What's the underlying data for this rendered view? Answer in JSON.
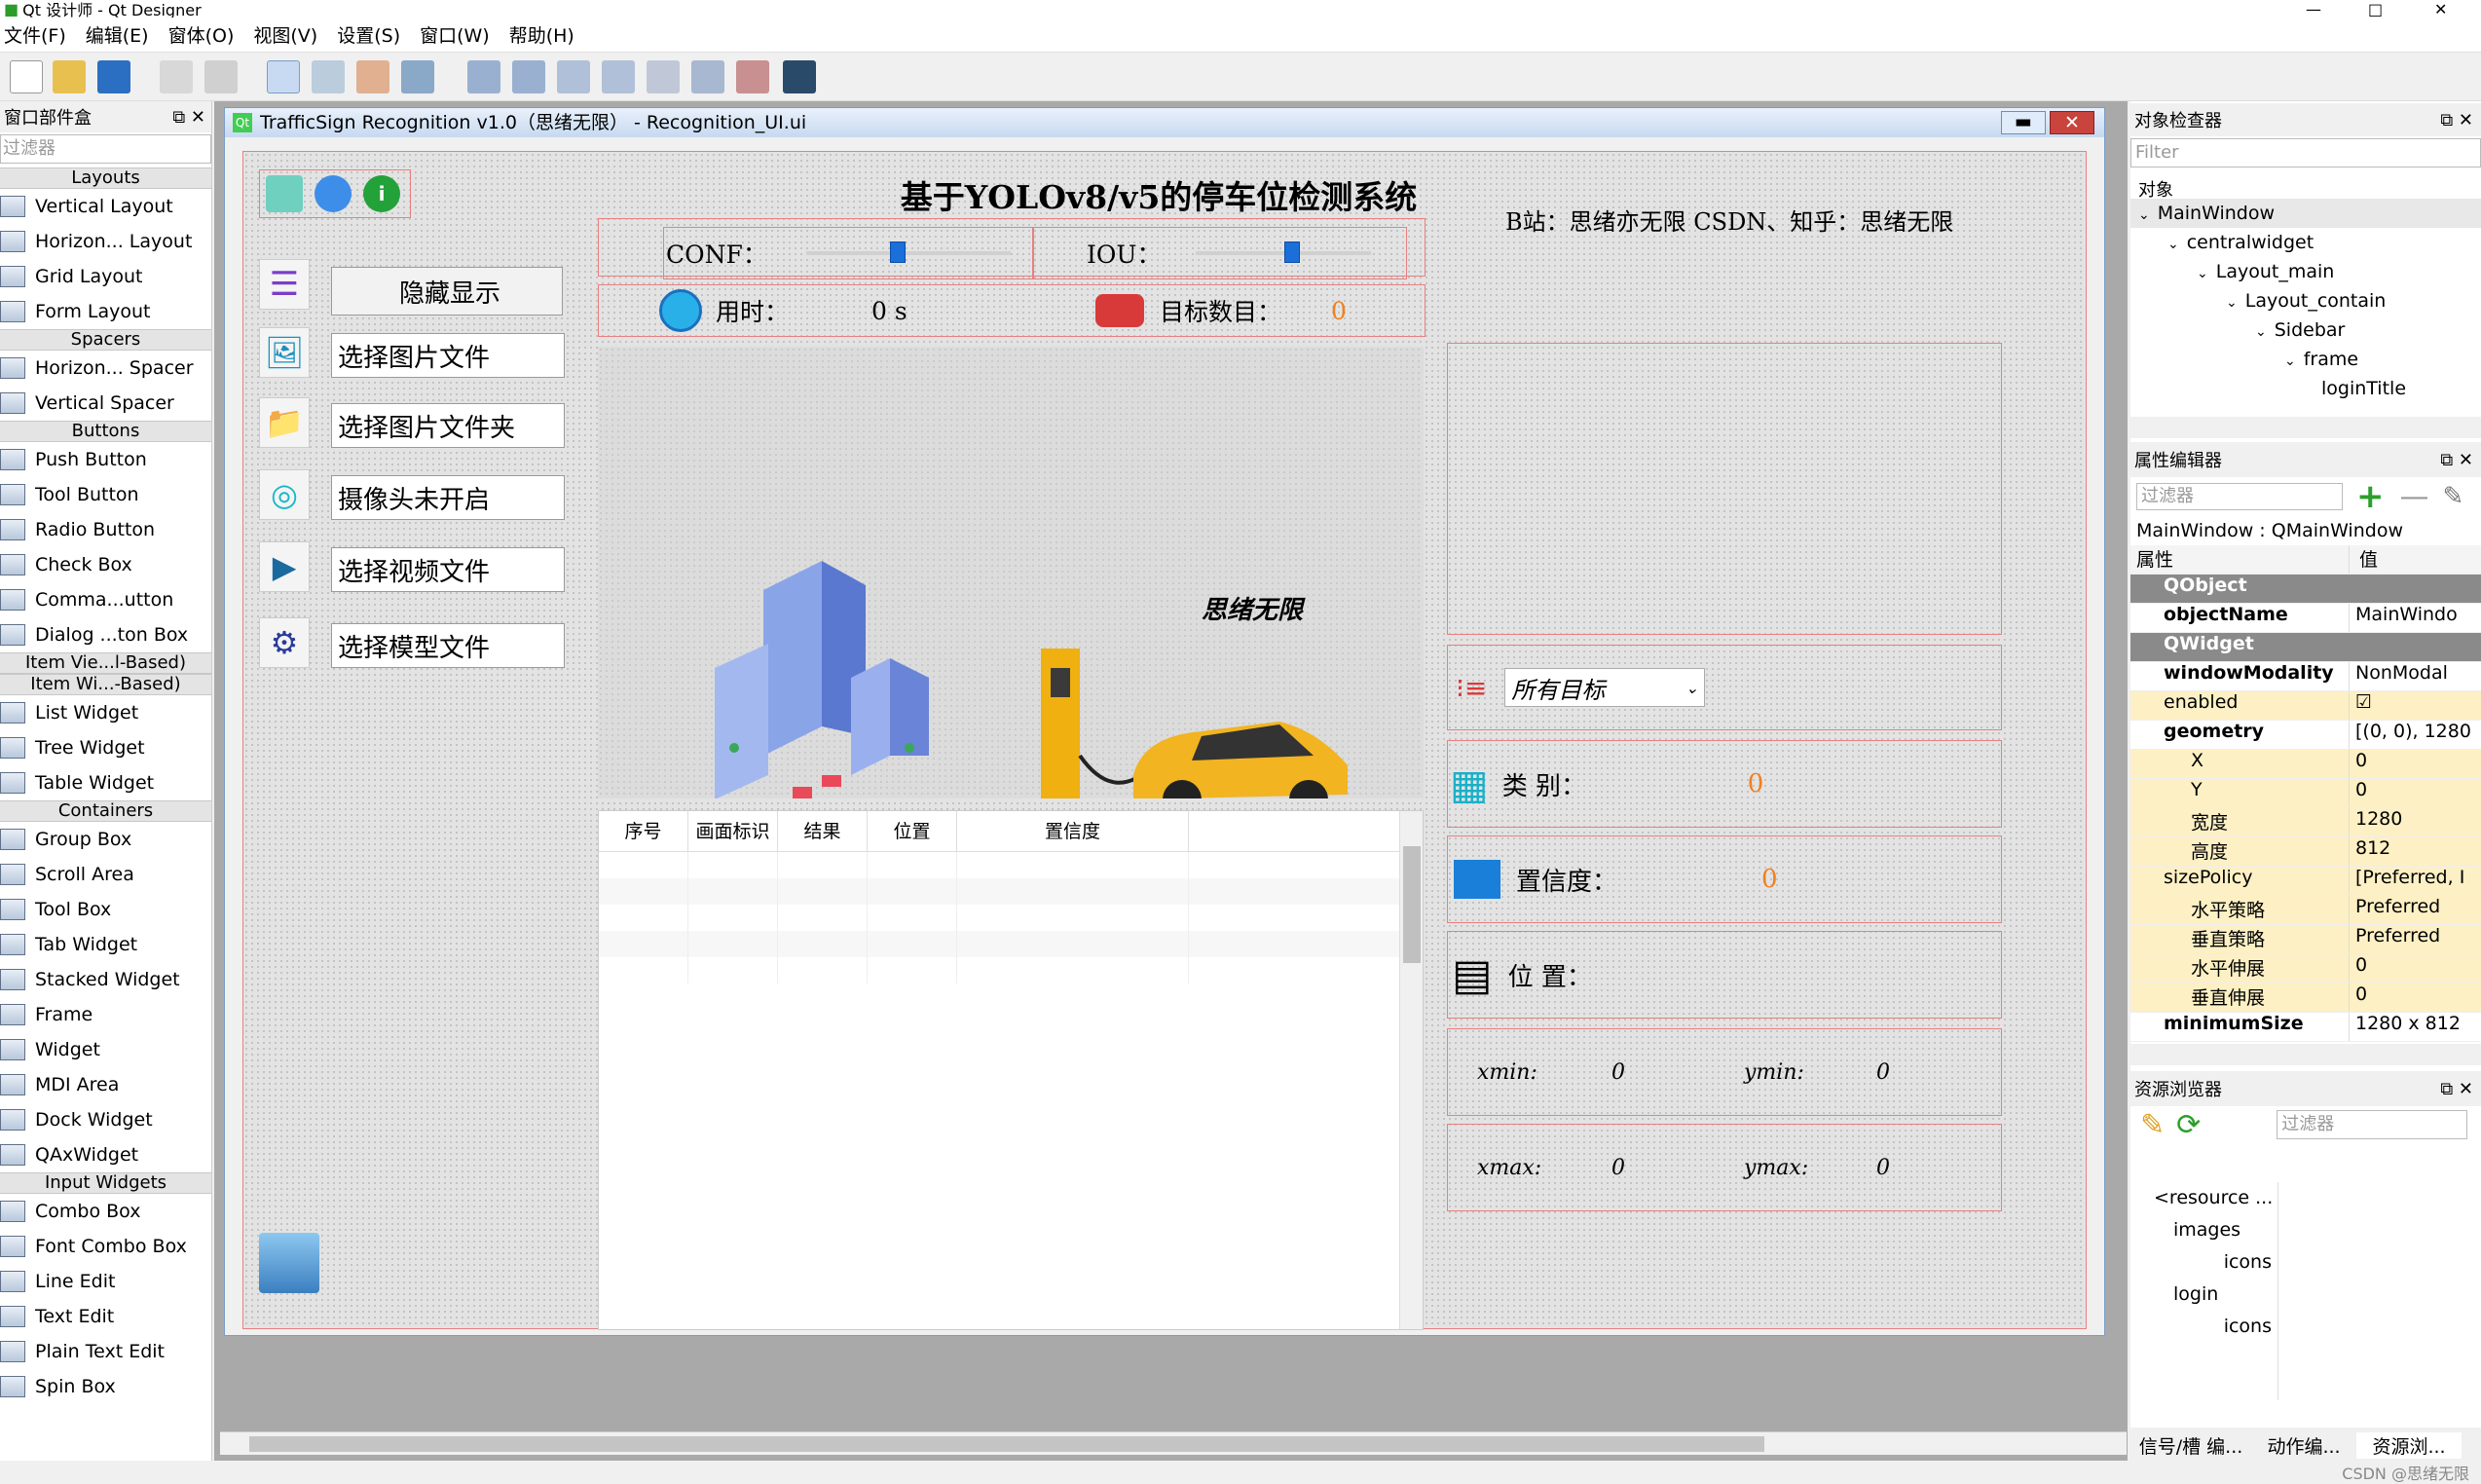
{
  "window": {
    "title": "Qt 设计师 - Qt Designer"
  },
  "menu": [
    "文件(F)",
    "编辑(E)",
    "窗体(O)",
    "视图(V)",
    "设置(S)",
    "窗口(W)",
    "帮助(H)"
  ],
  "widgetbox": {
    "title": "窗口部件盒",
    "filter": "过滤器",
    "sections": [
      {
        "cat": "Layouts",
        "items": [
          "Vertical Layout",
          "Horizon... Layout",
          "Grid Layout",
          "Form Layout"
        ]
      },
      {
        "cat": "Spacers",
        "items": [
          "Horizon... Spacer",
          "Vertical Spacer"
        ]
      },
      {
        "cat": "Buttons",
        "items": [
          "Push Button",
          "Tool Button",
          "Radio Button",
          "Check Box",
          "Comma...utton",
          "Dialog ...ton Box"
        ]
      },
      {
        "cat": "Item Vie...l-Based)",
        "items": []
      },
      {
        "cat": "Item Wi...-Based)",
        "items": [
          "List Widget",
          "Tree Widget",
          "Table Widget"
        ]
      },
      {
        "cat": "Containers",
        "items": [
          "Group Box",
          "Scroll Area",
          "Tool Box",
          "Tab Widget",
          "Stacked Widget",
          "Frame",
          "Widget",
          "MDI Area",
          "Dock Widget",
          "QAxWidget"
        ]
      },
      {
        "cat": "Input Widgets",
        "items": [
          "Combo Box",
          "Font Combo Box",
          "Line Edit",
          "Text Edit",
          "Plain Text Edit",
          "Spin Box"
        ]
      }
    ]
  },
  "form": {
    "title": "TrafficSign Recognition v1.0（思绪无限） - Recognition_UI.ui",
    "heading": "基于YOLOv8/v5的停车位检测系统",
    "sidebar": [
      "隐藏显示",
      "选择图片文件",
      "选择图片文件夹",
      "摄像头未开启",
      "选择视频文件",
      "选择模型文件"
    ],
    "conf_label": "CONF：",
    "iou_label": "IOU：",
    "conf": 0.45,
    "iou": 0.55,
    "time_label": "用时：",
    "time_value": "0 s",
    "count_label": "目标数目：",
    "count_value": "0",
    "brand_text": "思绪无限",
    "table_headers": [
      "序号",
      "画面标识",
      "结果",
      "位置",
      "置信度"
    ],
    "info": "B站：思绪亦无限 CSDN、知乎：思绪无限",
    "target_select": "所有目标",
    "class_label": "类 别：",
    "class_value": "0",
    "conf2_label": "置信度：",
    "conf2_value": "0",
    "pos_label": "位 置：",
    "xmin_label": "xmin:",
    "xmin": "0",
    "ymin_label": "ymin:",
    "ymin": "0",
    "xmax_label": "xmax:",
    "xmax": "0",
    "ymax_label": "ymax:",
    "ymax": "0"
  },
  "inspector": {
    "title": "对象检查器",
    "filter": "Filter",
    "col": "对象",
    "tree": [
      "MainWindow",
      "centralwidget",
      "Layout_main",
      "Layout_contain",
      "Sidebar",
      "frame",
      "loginTitle"
    ]
  },
  "props": {
    "title": "属性编辑器",
    "filter": "过滤器",
    "classline": "MainWindow : QMainWindow",
    "col_prop": "属性",
    "col_val": "值",
    "rows": [
      [
        "QObject",
        "",
        "grp"
      ],
      [
        "objectName",
        "MainWindo",
        "bold"
      ],
      [
        "QWidget",
        "",
        "grp"
      ],
      [
        "windowModality",
        "NonModal",
        "bold"
      ],
      [
        "enabled",
        "☑",
        "y"
      ],
      [
        "geometry",
        "[(0, 0), 1280",
        "bold"
      ],
      [
        "X",
        "0",
        "sub"
      ],
      [
        "Y",
        "0",
        "sub"
      ],
      [
        "宽度",
        "1280",
        "sub"
      ],
      [
        "高度",
        "812",
        "sub"
      ],
      [
        "sizePolicy",
        "[Preferred, I",
        "y"
      ],
      [
        "水平策略",
        "Preferred",
        "sub"
      ],
      [
        "垂直策略",
        "Preferred",
        "sub"
      ],
      [
        "水平伸展",
        "0",
        "sub"
      ],
      [
        "垂直伸展",
        "0",
        "sub"
      ],
      [
        "minimumSize",
        "1280 x 812",
        "bold"
      ]
    ]
  },
  "resources": {
    "title": "资源浏览器",
    "filter": "过滤器",
    "tree": [
      "<resource ...",
      "images",
      "icons",
      "login",
      "icons"
    ]
  },
  "bottomtabs": [
    "信号/槽 编...",
    "动作编...",
    "资源浏..."
  ],
  "watermark": "CSDN @思绪无限"
}
